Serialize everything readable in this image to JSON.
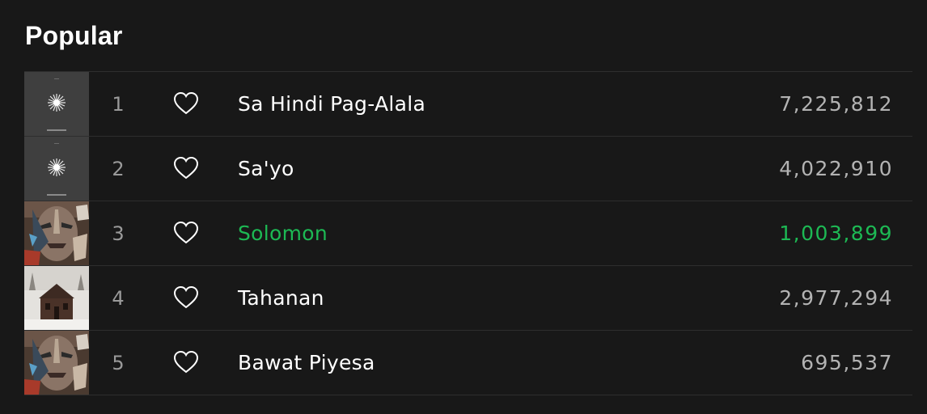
{
  "section": {
    "title": "Popular"
  },
  "colors": {
    "background": "#181818",
    "text": "#ffffff",
    "muted": "#b3b3b3",
    "accent": "#1db954",
    "divider": "#2e2e2e"
  },
  "tracks": [
    {
      "number": "1",
      "title": "Sa Hindi Pag-Alala",
      "plays": "7,225,812",
      "art": "starburst-cover",
      "liked_icon": "heart-outline-icon"
    },
    {
      "number": "2",
      "title": "Sa'yo",
      "plays": "4,022,910",
      "art": "starburst-cover",
      "liked_icon": "heart-outline-icon"
    },
    {
      "number": "3",
      "title": "Solomon",
      "plays": "1,003,899",
      "art": "painted-face-cover",
      "liked_icon": "heart-outline-icon",
      "active": true
    },
    {
      "number": "4",
      "title": "Tahanan",
      "plays": "2,977,294",
      "art": "cabin-cover",
      "liked_icon": "heart-outline-icon"
    },
    {
      "number": "5",
      "title": "Bawat Piyesa",
      "plays": "695,537",
      "art": "painted-face-cover",
      "liked_icon": "heart-outline-icon"
    }
  ]
}
